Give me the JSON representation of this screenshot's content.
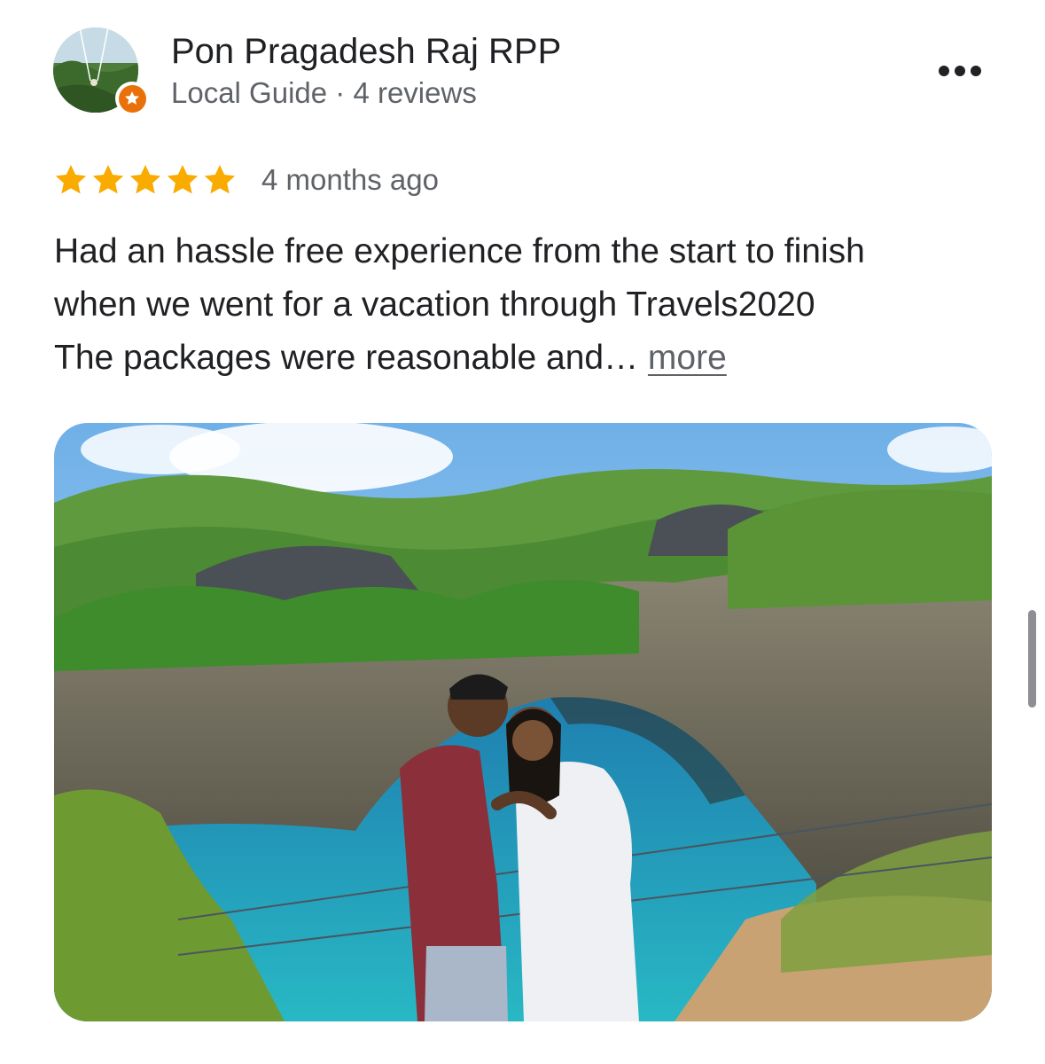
{
  "reviewer": {
    "name": "Pon Pragadesh Raj RPP",
    "meta": "Local Guide · 4 reviews",
    "avatar_icon": "profile-photo",
    "badge_icon": "local-guide-star-icon"
  },
  "menu": {
    "icon": "more-horizontal-icon"
  },
  "review": {
    "rating": 5,
    "max_rating": 5,
    "date": "4 months ago",
    "text_lines": [
      "Had an hassle free experience from the start to finish",
      "when we went for a vacation through Travels2020",
      "The packages were reasonable and… "
    ],
    "more_label": "more"
  },
  "photo": {
    "icon": "review-photo"
  },
  "colors": {
    "star": "#f9ab00",
    "badge": "#e8710a",
    "text_primary": "#202124",
    "text_secondary": "#5f6368"
  }
}
